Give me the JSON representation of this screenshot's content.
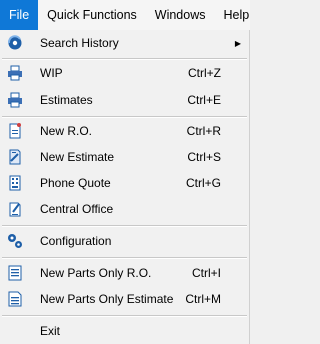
{
  "menubar": {
    "items": [
      "File",
      "Quick Functions",
      "Windows",
      "Help"
    ]
  },
  "menu": {
    "search_history": {
      "label": "Search History"
    },
    "wip": {
      "label": "WIP",
      "shortcut": "Ctrl+Z"
    },
    "estimates": {
      "label": "Estimates",
      "shortcut": "Ctrl+E"
    },
    "new_ro": {
      "label": "New R.O.",
      "shortcut": "Ctrl+R"
    },
    "new_estimate": {
      "label": "New Estimate",
      "shortcut": "Ctrl+S"
    },
    "phone_quote": {
      "label": "Phone Quote",
      "shortcut": "Ctrl+G"
    },
    "central_office": {
      "label": "Central Office"
    },
    "configuration": {
      "label": "Configuration"
    },
    "new_parts_ro": {
      "label": "New Parts Only R.O.",
      "shortcut": "Ctrl+I"
    },
    "new_parts_estimate": {
      "label": "New Parts Only Estimate",
      "shortcut": "Ctrl+M"
    },
    "exit": {
      "label": "Exit"
    }
  },
  "colors": {
    "accent": "#0f78d7",
    "icon_blue": "#1e5fa8"
  },
  "icons": {
    "search_history": "history-swirl-icon",
    "wip": "printer-icon",
    "estimates": "printer-icon",
    "new_ro": "document-new-icon",
    "new_estimate": "document-edit-icon",
    "phone_quote": "phone-list-icon",
    "central_office": "building-document-icon",
    "configuration": "gears-icon",
    "new_parts_ro": "document-lines-icon",
    "new_parts_estimate": "document-lines-icon"
  }
}
